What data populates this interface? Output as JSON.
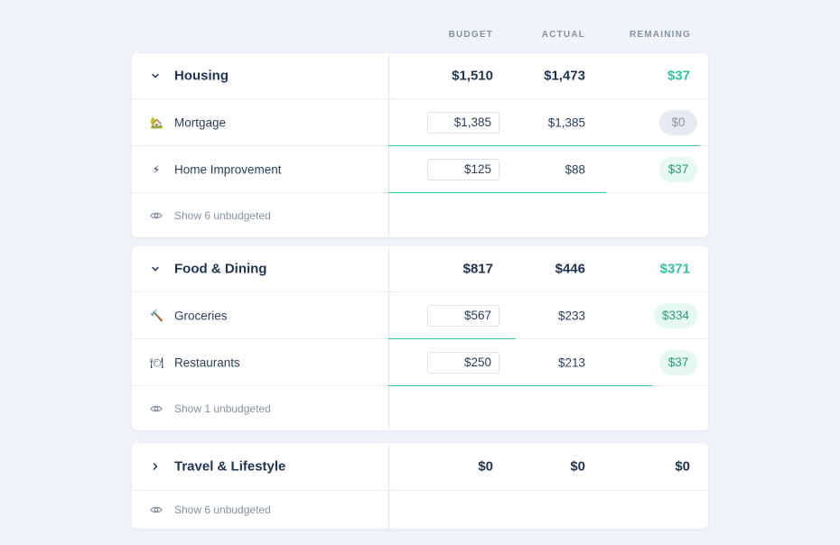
{
  "columns": {
    "budget": "BUDGET",
    "actual": "ACTUAL",
    "remaining": "REMAINING"
  },
  "colors": {
    "positive": "#2ec4a0",
    "positive_bg": "#e6f8f2",
    "neutral_bg": "#e6eaf0",
    "progress": "#33c9a0",
    "text": "#1f3356"
  },
  "groups": [
    {
      "title": "Housing",
      "expanded": true,
      "chevron": "chevron-down-icon",
      "budget": "$1,510",
      "actual": "$1,473",
      "remaining": "$37",
      "items": [
        {
          "icon": "house-icon",
          "glyph": "🏡",
          "label": "Mortgage",
          "budget": "$1,385",
          "actual": "$1,385",
          "remaining": "$0",
          "state": "zero",
          "progress": 1.0
        },
        {
          "icon": "lightning-icon",
          "glyph": "⚡",
          "label": "Home Improvement",
          "budget": "$125",
          "actual": "$88",
          "remaining": "$37",
          "state": "pos",
          "progress": 0.7
        }
      ],
      "more": "Show 6 unbudgeted"
    },
    {
      "title": "Food & Dining",
      "expanded": true,
      "chevron": "chevron-down-icon",
      "budget": "$817",
      "actual": "$446",
      "remaining": "$371",
      "items": [
        {
          "icon": "hammer-icon",
          "glyph": "🔨",
          "label": "Groceries",
          "budget": "$567",
          "actual": "$233",
          "remaining": "$334",
          "state": "pos",
          "progress": 0.41
        },
        {
          "icon": "plate-icon",
          "glyph": "🍽",
          "label": "Restaurants",
          "budget": "$250",
          "actual": "$213",
          "remaining": "$37",
          "state": "pos",
          "progress": 0.85
        }
      ],
      "more": "Show 1 unbudgeted"
    },
    {
      "title": "Travel & Lifestyle",
      "expanded": false,
      "chevron": "chevron-right-icon",
      "budget": "$0",
      "actual": "$0",
      "remaining": "$0",
      "items": [],
      "more": "Show 6 unbudgeted"
    }
  ]
}
